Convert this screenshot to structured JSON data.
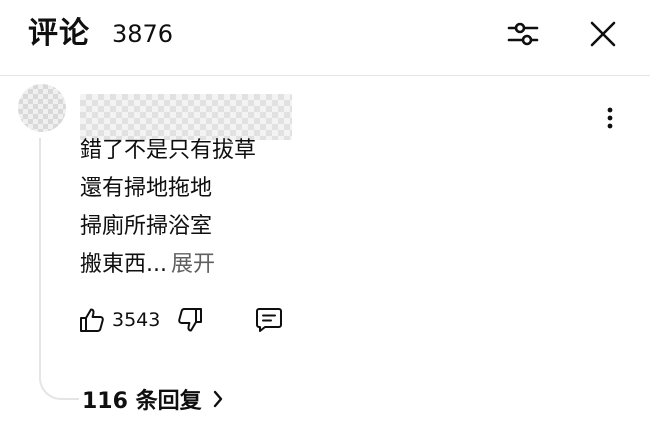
{
  "header": {
    "title": "评论",
    "count": "3876",
    "filter_icon": "sliders-icon",
    "close_icon": "close-icon"
  },
  "comment": {
    "lines": [
      "錯了不是只有拔草",
      "還有掃地拖地",
      "掃廁所掃浴室",
      "搬東西..."
    ],
    "expand_label": "展开",
    "like_count": "3543",
    "replies_label": "116 条回复",
    "menu_icon": "more-vert-icon"
  }
}
